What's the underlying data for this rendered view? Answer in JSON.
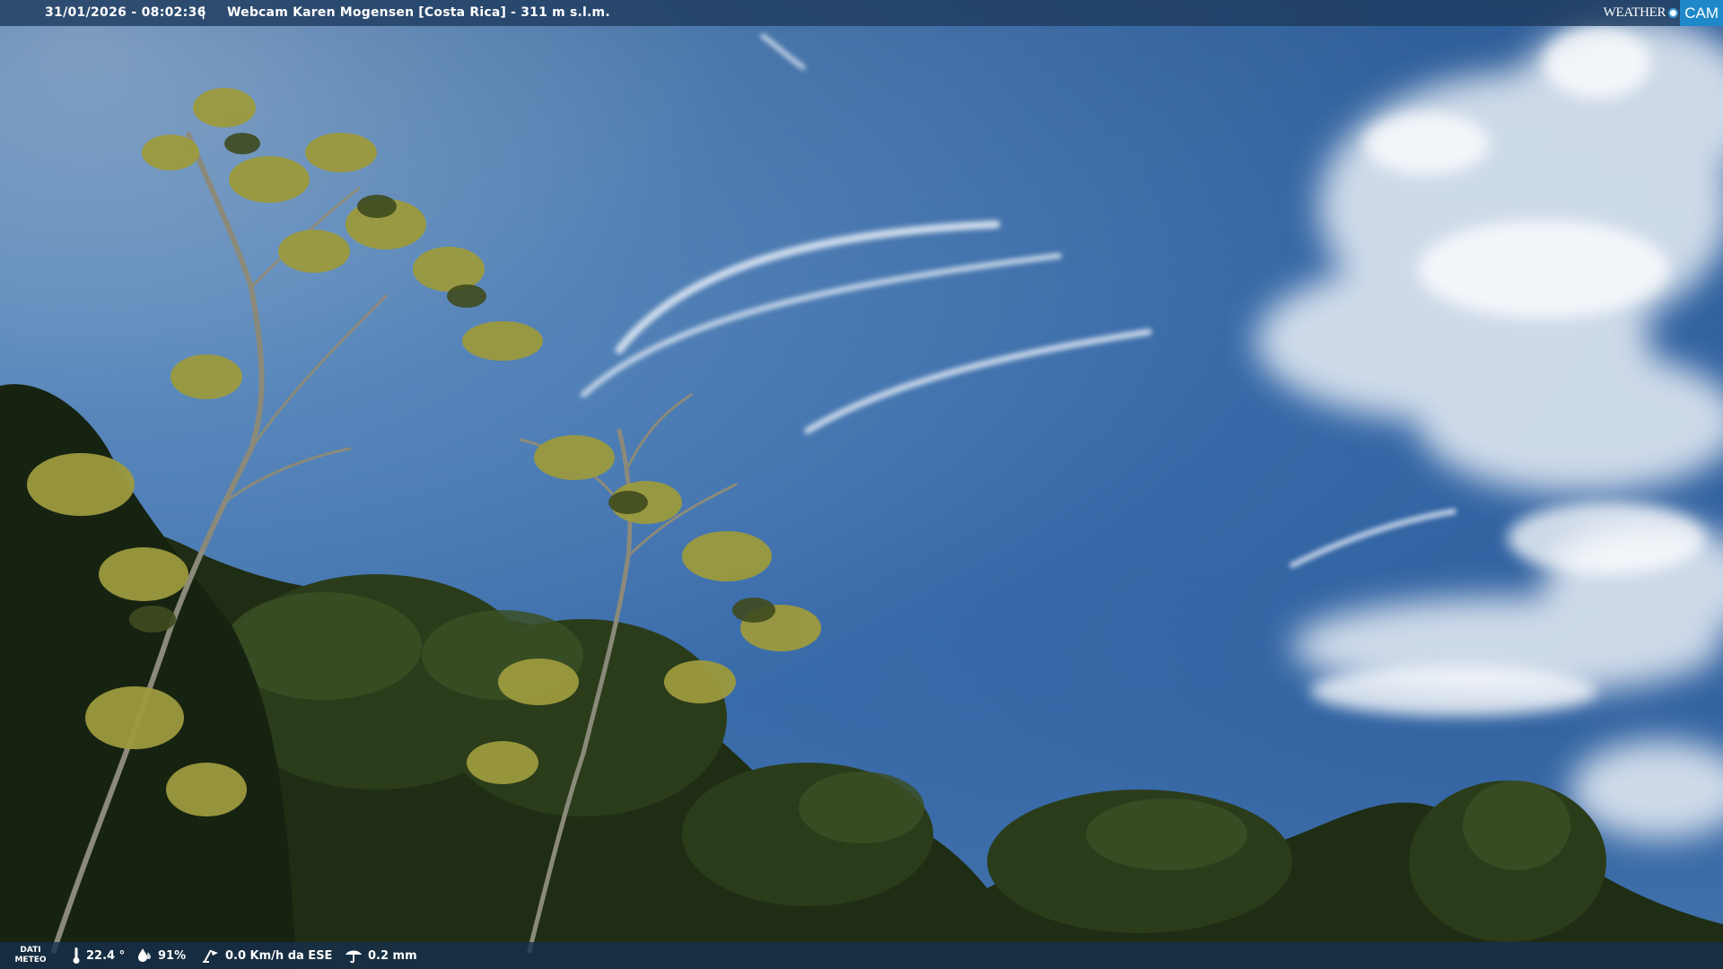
{
  "overlay": {
    "timestamp": "31/01/2026 - 08:02:36",
    "separator": "|",
    "caption": "Webcam Karen Mogensen [Costa Rica] - 311 m s.l.m.",
    "logo": {
      "word": "WEATHER",
      "cam": "CAM"
    }
  },
  "weather": {
    "label_line1": "DATI",
    "label_line2": "METEO",
    "temperature": "22.4 °",
    "humidity": "91%",
    "wind": "0.0 Km/h da ESE",
    "rain": "0.2 mm"
  },
  "icons": {
    "temperature": "thermometer-icon",
    "humidity": "humidity-drop-icon",
    "wind": "wind-icon",
    "rain": "rain-icon"
  },
  "colors": {
    "sky_top": "#3b6aa6",
    "sky_light": "#8fb4d6",
    "foliage_dark": "#1d2a14",
    "logo_blue": "#1e88c9"
  }
}
